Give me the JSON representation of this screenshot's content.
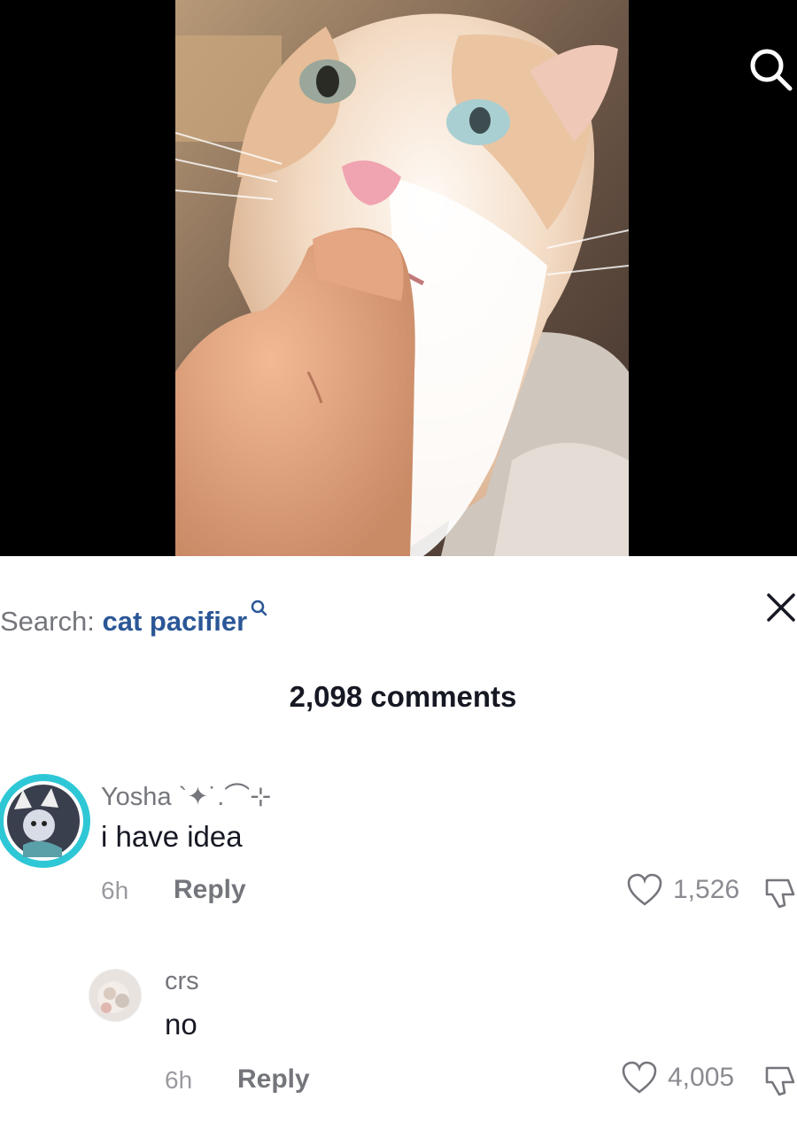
{
  "search": {
    "prefix": "Search:",
    "query": "cat pacifier"
  },
  "comments_header": {
    "count_label": "2,098 comments"
  },
  "comments": [
    {
      "username": "Yosha `✦˙.⌒⊹",
      "text": "i have idea",
      "time": "6h",
      "reply_label": "Reply",
      "likes": "1,526"
    },
    {
      "username": "crs",
      "text": "no",
      "time": "6h",
      "reply_label": "Reply",
      "likes": "4,005"
    }
  ],
  "icons": {
    "video_search": "search-icon",
    "search_inline": "search-icon",
    "close": "close-icon",
    "like": "heart-icon",
    "dislike": "dislike-icon"
  },
  "colors": {
    "search_term": "#2b5797",
    "avatar_ring": "#2ec7d6",
    "primary_text": "#161823",
    "secondary_text": "#74767c"
  }
}
